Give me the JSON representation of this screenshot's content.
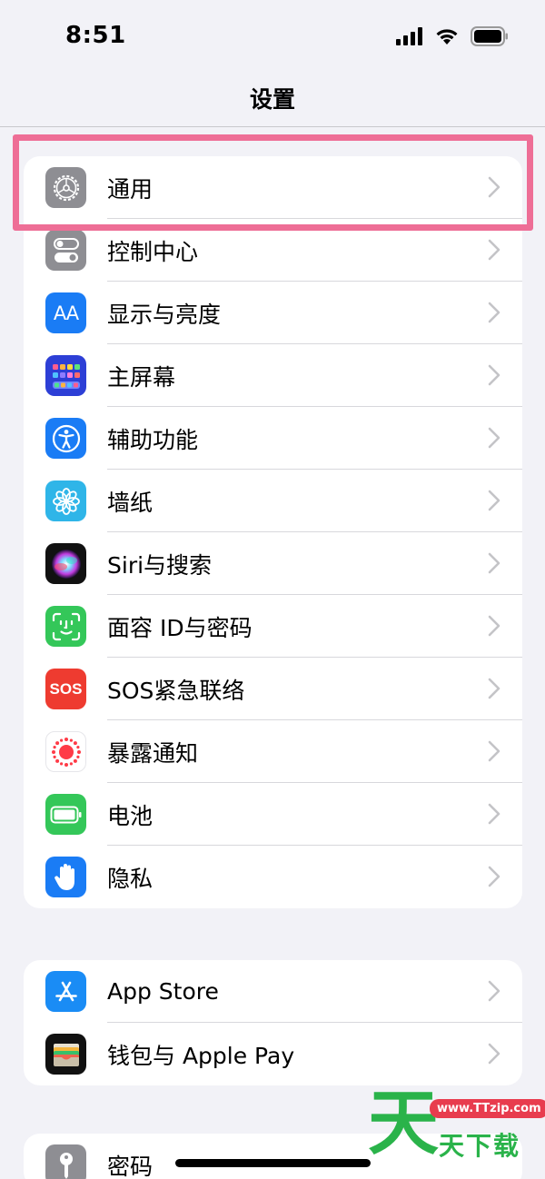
{
  "status": {
    "time": "8:51"
  },
  "nav": {
    "title": "设置"
  },
  "group1": [
    {
      "label": "通用",
      "icon": "gear-icon"
    },
    {
      "label": "控制中心",
      "icon": "control-center-icon"
    },
    {
      "label": "显示与亮度",
      "icon": "display-brightness-icon"
    },
    {
      "label": "主屏幕",
      "icon": "home-screen-icon"
    },
    {
      "label": "辅助功能",
      "icon": "accessibility-icon"
    },
    {
      "label": "墙纸",
      "icon": "wallpaper-icon"
    },
    {
      "label": "Siri与搜索",
      "icon": "siri-icon"
    },
    {
      "label": "面容 ID与密码",
      "icon": "face-id-icon"
    },
    {
      "label": "SOS紧急联络",
      "icon": "sos-icon",
      "icon_text": "SOS"
    },
    {
      "label": "暴露通知",
      "icon": "exposure-notification-icon"
    },
    {
      "label": "电池",
      "icon": "battery-icon"
    },
    {
      "label": "隐私",
      "icon": "privacy-hand-icon"
    }
  ],
  "group2": [
    {
      "label": "App Store",
      "icon": "app-store-icon"
    },
    {
      "label": "钱包与 Apple Pay",
      "icon": "wallet-icon"
    }
  ],
  "group3": [
    {
      "label": "密码",
      "icon": "key-icon"
    }
  ],
  "display_icon_text": "AA",
  "watermark": {
    "url": "www.TTzip.com",
    "big": "天",
    "small": "天下载"
  },
  "colors": {
    "background": "#f2f2f7",
    "highlight_border": "#ee6e96",
    "chevron": "#c4c4c7",
    "separator": "#d8d8dc",
    "watermark_green": "#2ab34a",
    "watermark_red": "#e83c4e"
  }
}
